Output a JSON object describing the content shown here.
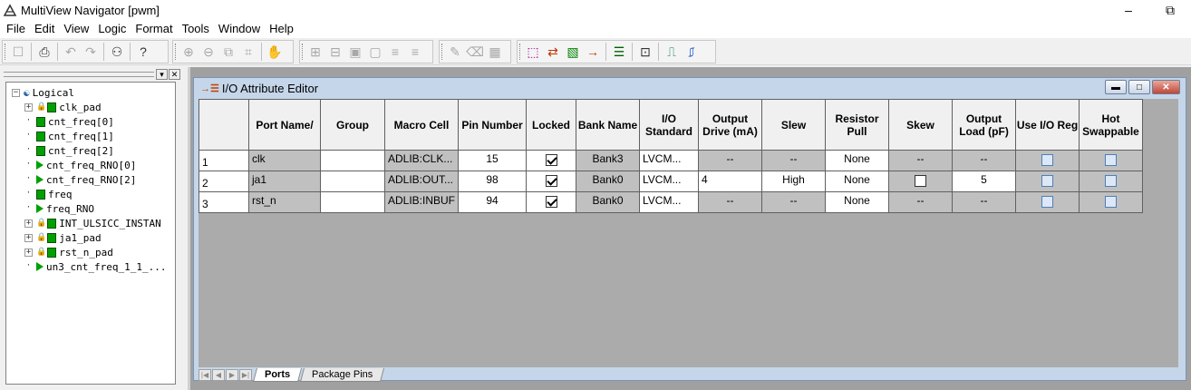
{
  "window": {
    "title": "MultiView Navigator [pwm]",
    "minimize": "–",
    "restore": "⧉"
  },
  "menu": [
    "File",
    "Edit",
    "View",
    "Logic",
    "Format",
    "Tools",
    "Window",
    "Help"
  ],
  "toolbar": {
    "icons": [
      "bin-icon",
      "print-icon",
      "undo-icon",
      "redo-icon",
      "find-icon",
      "help-icon",
      "zoom-in-icon",
      "zoom-out-icon",
      "zoom-area-icon",
      "zoom-fit-icon",
      "pan-icon",
      "expand-icon",
      "collapse-icon",
      "lock-icon",
      "unlock-icon",
      "bus-icon",
      "bus2-icon",
      "pencil-icon",
      "eraser-icon",
      "grid-icon",
      "chip-icon",
      "net-icon",
      "view-icon",
      "io-editor-icon",
      "sheet-icon",
      "assign-icon",
      "wave-icon",
      "wave2-icon"
    ],
    "glyphs": [
      "☐",
      "⎙",
      "↶",
      "↷",
      "⚇",
      "?",
      "⊕",
      "⊖",
      "⧉",
      "⌗",
      "✋",
      "⊞",
      "⊟",
      "▣",
      "▢",
      "≡",
      "≡",
      "✎",
      "⌫",
      "▦",
      "⬚",
      "⇄",
      "▧",
      "→",
      "☰",
      "⊡",
      "⎍",
      "⎎"
    ]
  },
  "tree": {
    "root": "Logical",
    "items": [
      {
        "label": "clk_pad",
        "expand": true,
        "lock": true,
        "kind": "pad"
      },
      {
        "label": "cnt_freq[0]",
        "expand": false,
        "lock": false,
        "kind": "pad"
      },
      {
        "label": "cnt_freq[1]",
        "expand": false,
        "lock": false,
        "kind": "pad"
      },
      {
        "label": "cnt_freq[2]",
        "expand": false,
        "lock": false,
        "kind": "pad"
      },
      {
        "label": "cnt_freq_RNO[0]",
        "expand": false,
        "lock": false,
        "kind": "tri"
      },
      {
        "label": "cnt_freq_RNO[2]",
        "expand": false,
        "lock": false,
        "kind": "tri"
      },
      {
        "label": "freq",
        "expand": false,
        "lock": false,
        "kind": "pad"
      },
      {
        "label": "freq_RNO",
        "expand": false,
        "lock": false,
        "kind": "tri"
      },
      {
        "label": "INT_ULSICC_INSTAN",
        "expand": true,
        "lock": true,
        "kind": "pad"
      },
      {
        "label": "ja1_pad",
        "expand": true,
        "lock": true,
        "kind": "pad"
      },
      {
        "label": "rst_n_pad",
        "expand": true,
        "lock": true,
        "kind": "pad"
      },
      {
        "label": "un3_cnt_freq_1_1_...",
        "expand": false,
        "lock": false,
        "kind": "tri"
      }
    ]
  },
  "editor": {
    "title": "I/O Attribute Editor",
    "columns": [
      "",
      "Port Name/",
      "Group",
      "Macro Cell",
      "Pin Number",
      "Locked",
      "Bank Name",
      "I/O Standard",
      "Output Drive (mA)",
      "Slew",
      "Resistor Pull",
      "Skew",
      "Output Load (pF)",
      "Use I/O Reg",
      "Hot Swappable"
    ],
    "rows": [
      {
        "num": "1",
        "port": "clk",
        "group": "",
        "macro": "ADLIB:CLK...",
        "pin": "15",
        "locked": true,
        "bank": "Bank3",
        "iostd": "LVCM...",
        "drive": "--",
        "slew": "--",
        "pull": "None",
        "skew": "--",
        "skew_box": false,
        "load": "--",
        "load_white": false
      },
      {
        "num": "2",
        "port": "ja1",
        "group": "",
        "macro": "ADLIB:OUT...",
        "pin": "98",
        "locked": true,
        "bank": "Bank0",
        "iostd": "LVCM...",
        "drive": "4",
        "slew": "High",
        "pull": "None",
        "skew": "",
        "skew_box": true,
        "load": "5",
        "load_white": true
      },
      {
        "num": "3",
        "port": "rst_n",
        "group": "",
        "macro": "ADLIB:INBUF",
        "pin": "94",
        "locked": true,
        "bank": "Bank0",
        "iostd": "LVCM...",
        "drive": "--",
        "slew": "--",
        "pull": "None",
        "skew": "--",
        "skew_box": false,
        "load": "--",
        "load_white": false
      }
    ],
    "tabs": [
      "Ports",
      "Package Pins"
    ]
  }
}
